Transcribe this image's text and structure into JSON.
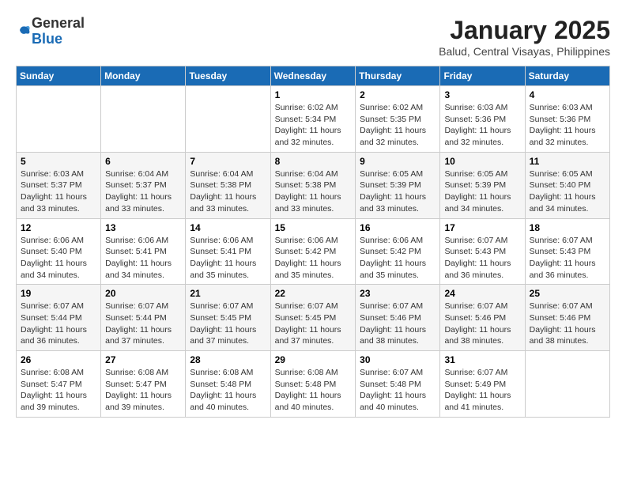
{
  "logo": {
    "general": "General",
    "blue": "Blue"
  },
  "header": {
    "month": "January 2025",
    "location": "Balud, Central Visayas, Philippines"
  },
  "weekdays": [
    "Sunday",
    "Monday",
    "Tuesday",
    "Wednesday",
    "Thursday",
    "Friday",
    "Saturday"
  ],
  "weeks": [
    [
      {
        "day": "",
        "sunrise": "",
        "sunset": "",
        "daylight": ""
      },
      {
        "day": "",
        "sunrise": "",
        "sunset": "",
        "daylight": ""
      },
      {
        "day": "",
        "sunrise": "",
        "sunset": "",
        "daylight": ""
      },
      {
        "day": "1",
        "sunrise": "Sunrise: 6:02 AM",
        "sunset": "Sunset: 5:34 PM",
        "daylight": "Daylight: 11 hours and 32 minutes."
      },
      {
        "day": "2",
        "sunrise": "Sunrise: 6:02 AM",
        "sunset": "Sunset: 5:35 PM",
        "daylight": "Daylight: 11 hours and 32 minutes."
      },
      {
        "day": "3",
        "sunrise": "Sunrise: 6:03 AM",
        "sunset": "Sunset: 5:36 PM",
        "daylight": "Daylight: 11 hours and 32 minutes."
      },
      {
        "day": "4",
        "sunrise": "Sunrise: 6:03 AM",
        "sunset": "Sunset: 5:36 PM",
        "daylight": "Daylight: 11 hours and 32 minutes."
      }
    ],
    [
      {
        "day": "5",
        "sunrise": "Sunrise: 6:03 AM",
        "sunset": "Sunset: 5:37 PM",
        "daylight": "Daylight: 11 hours and 33 minutes."
      },
      {
        "day": "6",
        "sunrise": "Sunrise: 6:04 AM",
        "sunset": "Sunset: 5:37 PM",
        "daylight": "Daylight: 11 hours and 33 minutes."
      },
      {
        "day": "7",
        "sunrise": "Sunrise: 6:04 AM",
        "sunset": "Sunset: 5:38 PM",
        "daylight": "Daylight: 11 hours and 33 minutes."
      },
      {
        "day": "8",
        "sunrise": "Sunrise: 6:04 AM",
        "sunset": "Sunset: 5:38 PM",
        "daylight": "Daylight: 11 hours and 33 minutes."
      },
      {
        "day": "9",
        "sunrise": "Sunrise: 6:05 AM",
        "sunset": "Sunset: 5:39 PM",
        "daylight": "Daylight: 11 hours and 33 minutes."
      },
      {
        "day": "10",
        "sunrise": "Sunrise: 6:05 AM",
        "sunset": "Sunset: 5:39 PM",
        "daylight": "Daylight: 11 hours and 34 minutes."
      },
      {
        "day": "11",
        "sunrise": "Sunrise: 6:05 AM",
        "sunset": "Sunset: 5:40 PM",
        "daylight": "Daylight: 11 hours and 34 minutes."
      }
    ],
    [
      {
        "day": "12",
        "sunrise": "Sunrise: 6:06 AM",
        "sunset": "Sunset: 5:40 PM",
        "daylight": "Daylight: 11 hours and 34 minutes."
      },
      {
        "day": "13",
        "sunrise": "Sunrise: 6:06 AM",
        "sunset": "Sunset: 5:41 PM",
        "daylight": "Daylight: 11 hours and 34 minutes."
      },
      {
        "day": "14",
        "sunrise": "Sunrise: 6:06 AM",
        "sunset": "Sunset: 5:41 PM",
        "daylight": "Daylight: 11 hours and 35 minutes."
      },
      {
        "day": "15",
        "sunrise": "Sunrise: 6:06 AM",
        "sunset": "Sunset: 5:42 PM",
        "daylight": "Daylight: 11 hours and 35 minutes."
      },
      {
        "day": "16",
        "sunrise": "Sunrise: 6:06 AM",
        "sunset": "Sunset: 5:42 PM",
        "daylight": "Daylight: 11 hours and 35 minutes."
      },
      {
        "day": "17",
        "sunrise": "Sunrise: 6:07 AM",
        "sunset": "Sunset: 5:43 PM",
        "daylight": "Daylight: 11 hours and 36 minutes."
      },
      {
        "day": "18",
        "sunrise": "Sunrise: 6:07 AM",
        "sunset": "Sunset: 5:43 PM",
        "daylight": "Daylight: 11 hours and 36 minutes."
      }
    ],
    [
      {
        "day": "19",
        "sunrise": "Sunrise: 6:07 AM",
        "sunset": "Sunset: 5:44 PM",
        "daylight": "Daylight: 11 hours and 36 minutes."
      },
      {
        "day": "20",
        "sunrise": "Sunrise: 6:07 AM",
        "sunset": "Sunset: 5:44 PM",
        "daylight": "Daylight: 11 hours and 37 minutes."
      },
      {
        "day": "21",
        "sunrise": "Sunrise: 6:07 AM",
        "sunset": "Sunset: 5:45 PM",
        "daylight": "Daylight: 11 hours and 37 minutes."
      },
      {
        "day": "22",
        "sunrise": "Sunrise: 6:07 AM",
        "sunset": "Sunset: 5:45 PM",
        "daylight": "Daylight: 11 hours and 37 minutes."
      },
      {
        "day": "23",
        "sunrise": "Sunrise: 6:07 AM",
        "sunset": "Sunset: 5:46 PM",
        "daylight": "Daylight: 11 hours and 38 minutes."
      },
      {
        "day": "24",
        "sunrise": "Sunrise: 6:07 AM",
        "sunset": "Sunset: 5:46 PM",
        "daylight": "Daylight: 11 hours and 38 minutes."
      },
      {
        "day": "25",
        "sunrise": "Sunrise: 6:07 AM",
        "sunset": "Sunset: 5:46 PM",
        "daylight": "Daylight: 11 hours and 38 minutes."
      }
    ],
    [
      {
        "day": "26",
        "sunrise": "Sunrise: 6:08 AM",
        "sunset": "Sunset: 5:47 PM",
        "daylight": "Daylight: 11 hours and 39 minutes."
      },
      {
        "day": "27",
        "sunrise": "Sunrise: 6:08 AM",
        "sunset": "Sunset: 5:47 PM",
        "daylight": "Daylight: 11 hours and 39 minutes."
      },
      {
        "day": "28",
        "sunrise": "Sunrise: 6:08 AM",
        "sunset": "Sunset: 5:48 PM",
        "daylight": "Daylight: 11 hours and 40 minutes."
      },
      {
        "day": "29",
        "sunrise": "Sunrise: 6:08 AM",
        "sunset": "Sunset: 5:48 PM",
        "daylight": "Daylight: 11 hours and 40 minutes."
      },
      {
        "day": "30",
        "sunrise": "Sunrise: 6:07 AM",
        "sunset": "Sunset: 5:48 PM",
        "daylight": "Daylight: 11 hours and 40 minutes."
      },
      {
        "day": "31",
        "sunrise": "Sunrise: 6:07 AM",
        "sunset": "Sunset: 5:49 PM",
        "daylight": "Daylight: 11 hours and 41 minutes."
      },
      {
        "day": "",
        "sunrise": "",
        "sunset": "",
        "daylight": ""
      }
    ]
  ]
}
